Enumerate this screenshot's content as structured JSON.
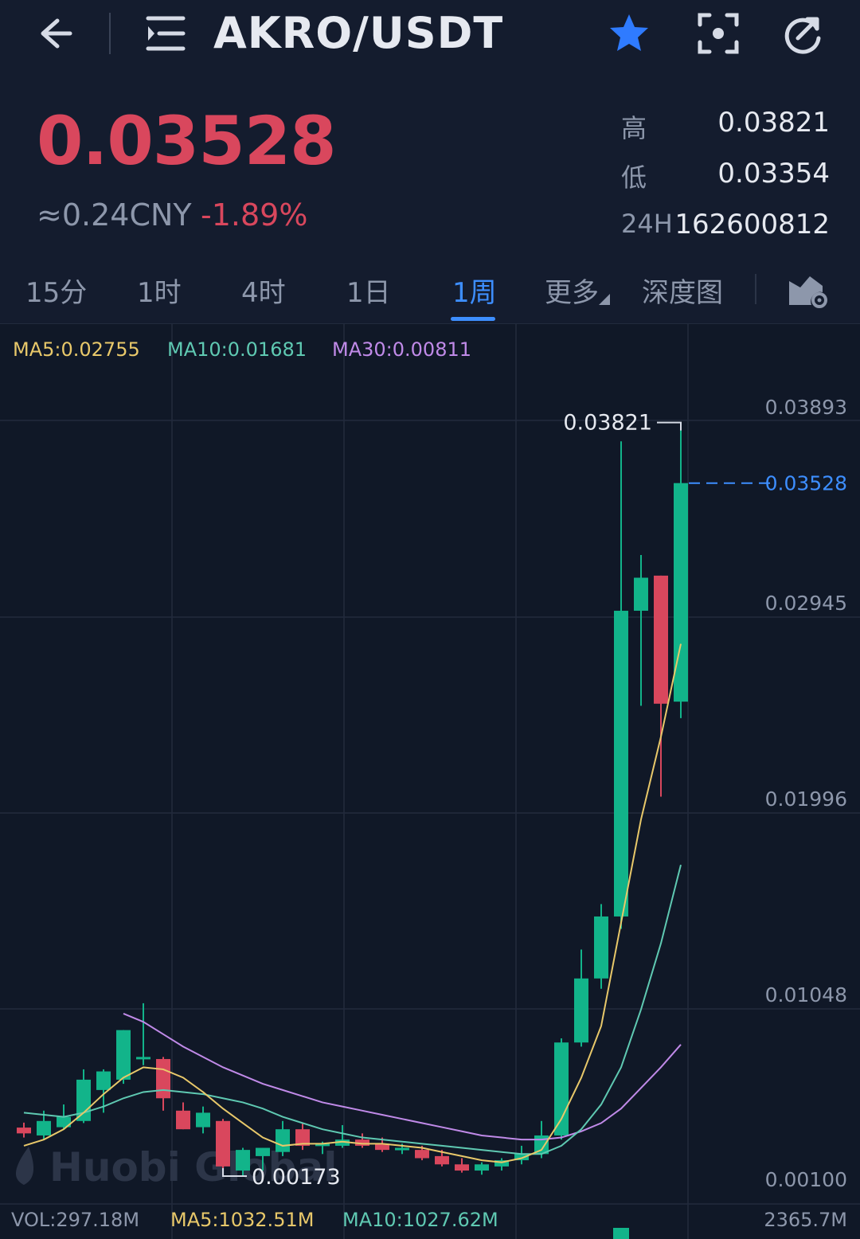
{
  "header": {
    "title": "AKRO/USDT"
  },
  "ticker": {
    "last_price": "0.03528",
    "cny": "≈0.24CNY",
    "change_pct": "-1.89%",
    "high_label": "高",
    "high_value": "0.03821",
    "low_label": "低",
    "low_value": "0.03354",
    "vol_label": "24H",
    "vol_value": "162600812"
  },
  "tabs": [
    {
      "label": "15分"
    },
    {
      "label": "1时"
    },
    {
      "label": "4时"
    },
    {
      "label": "1日"
    },
    {
      "label": "1周"
    },
    {
      "label": "更多"
    },
    {
      "label": "深度图"
    }
  ],
  "active_tab": "1周",
  "indicators": {
    "ma5": "MA5:0.02755",
    "ma10": "MA10:0.01681",
    "ma30": "MA30:0.00811"
  },
  "volume": {
    "vol": "VOL:297.18M",
    "ma5": "MA5:1032.51M",
    "ma10": "MA10:1027.62M",
    "max": "2365.7M"
  },
  "watermark": "Huobi Global",
  "colors": {
    "up": "#12b48a",
    "down": "#d9475d",
    "accent": "#3d8eff",
    "ma5": "#e8c86a",
    "ma10": "#5fc9b2",
    "ma30": "#c08ae8"
  },
  "chart_data": {
    "type": "candlestick",
    "y_axis_labels": [
      "0.03893",
      "0.02945",
      "0.01996",
      "0.01048",
      "0.00100"
    ],
    "ylim": [
      0.001,
      0.03893
    ],
    "current_price_label": "0.03528",
    "max_label": "0.03821",
    "min_label": "0.00173",
    "candles": [
      {
        "o": 0.00408,
        "h": 0.00432,
        "l": 0.0036,
        "c": 0.0038
      },
      {
        "o": 0.0037,
        "h": 0.0049,
        "l": 0.0035,
        "c": 0.0044
      },
      {
        "o": 0.0041,
        "h": 0.0052,
        "l": 0.004,
        "c": 0.0046
      },
      {
        "o": 0.0044,
        "h": 0.0069,
        "l": 0.0043,
        "c": 0.0064
      },
      {
        "o": 0.0059,
        "h": 0.0069,
        "l": 0.0048,
        "c": 0.0068
      },
      {
        "o": 0.0064,
        "h": 0.0077,
        "l": 0.0062,
        "c": 0.0088
      },
      {
        "o": 0.0074,
        "h": 0.0101,
        "l": 0.0071,
        "c": 0.0075
      },
      {
        "o": 0.0074,
        "h": 0.0075,
        "l": 0.0049,
        "c": 0.0055
      },
      {
        "o": 0.0049,
        "h": 0.0053,
        "l": 0.0043,
        "c": 0.004
      },
      {
        "o": 0.0041,
        "h": 0.0051,
        "l": 0.0038,
        "c": 0.0048
      },
      {
        "o": 0.0044,
        "h": 0.0045,
        "l": 0.00173,
        "c": 0.0022
      },
      {
        "o": 0.002,
        "h": 0.0031,
        "l": 0.00173,
        "c": 0.003
      },
      {
        "o": 0.0027,
        "h": 0.0031,
        "l": 0.002,
        "c": 0.0031
      },
      {
        "o": 0.0029,
        "h": 0.0044,
        "l": 0.0027,
        "c": 0.004
      },
      {
        "o": 0.004,
        "h": 0.0043,
        "l": 0.003,
        "c": 0.0032
      },
      {
        "o": 0.0032,
        "h": 0.0034,
        "l": 0.0028,
        "c": 0.0033
      },
      {
        "o": 0.0032,
        "h": 0.0042,
        "l": 0.0031,
        "c": 0.0035
      },
      {
        "o": 0.0035,
        "h": 0.0038,
        "l": 0.0031,
        "c": 0.0032
      },
      {
        "o": 0.0033,
        "h": 0.0036,
        "l": 0.0029,
        "c": 0.003
      },
      {
        "o": 0.003,
        "h": 0.0033,
        "l": 0.0028,
        "c": 0.0031
      },
      {
        "o": 0.003,
        "h": 0.0032,
        "l": 0.0025,
        "c": 0.0026
      },
      {
        "o": 0.0027,
        "h": 0.003,
        "l": 0.0022,
        "c": 0.0023
      },
      {
        "o": 0.0023,
        "h": 0.0026,
        "l": 0.0019,
        "c": 0.002
      },
      {
        "o": 0.002,
        "h": 0.0024,
        "l": 0.0018,
        "c": 0.0023
      },
      {
        "o": 0.0022,
        "h": 0.0026,
        "l": 0.002,
        "c": 0.0025
      },
      {
        "o": 0.0025,
        "h": 0.0032,
        "l": 0.0023,
        "c": 0.0028
      },
      {
        "o": 0.0028,
        "h": 0.0044,
        "l": 0.0026,
        "c": 0.0037
      },
      {
        "o": 0.0037,
        "h": 0.0084,
        "l": 0.0035,
        "c": 0.0082
      },
      {
        "o": 0.0082,
        "h": 0.0127,
        "l": 0.008,
        "c": 0.0113
      },
      {
        "o": 0.0113,
        "h": 0.0149,
        "l": 0.0108,
        "c": 0.0143
      },
      {
        "o": 0.0143,
        "h": 0.0373,
        "l": 0.0137,
        "c": 0.0291
      },
      {
        "o": 0.0291,
        "h": 0.0318,
        "l": 0.0245,
        "c": 0.0307
      },
      {
        "o": 0.0308,
        "h": 0.029,
        "l": 0.0201,
        "c": 0.0246
      },
      {
        "o": 0.0247,
        "h": 0.03821,
        "l": 0.0239,
        "c": 0.03528
      }
    ],
    "ma5": [
      0.0032,
      0.0035,
      0.004,
      0.0048,
      0.0057,
      0.0065,
      0.007,
      0.0069,
      0.0065,
      0.0058,
      0.005,
      0.0043,
      0.0036,
      0.0032,
      0.0033,
      0.0033,
      0.0034,
      0.0033,
      0.0033,
      0.0032,
      0.0031,
      0.0029,
      0.0027,
      0.0025,
      0.0024,
      0.0026,
      0.003,
      0.0045,
      0.0065,
      0.009,
      0.014,
      0.019,
      0.023,
      0.0275
    ],
    "ma10": [
      0.0048,
      0.0047,
      0.0046,
      0.0048,
      0.0051,
      0.0055,
      0.0058,
      0.0059,
      0.0058,
      0.0057,
      0.0055,
      0.0053,
      0.005,
      0.0046,
      0.0043,
      0.004,
      0.0038,
      0.0036,
      0.0035,
      0.0034,
      0.0033,
      0.0032,
      0.0031,
      0.003,
      0.0029,
      0.0028,
      0.0028,
      0.0032,
      0.004,
      0.0052,
      0.007,
      0.0098,
      0.013,
      0.0168
    ],
    "ma30": [
      null,
      null,
      null,
      null,
      null,
      0.0096,
      0.0092,
      0.0086,
      0.008,
      0.0075,
      0.007,
      0.0066,
      0.0062,
      0.0059,
      0.0056,
      0.0053,
      0.0051,
      0.0049,
      0.0047,
      0.0045,
      0.0043,
      0.0041,
      0.0039,
      0.0037,
      0.0036,
      0.0035,
      0.0035,
      0.0036,
      0.0039,
      0.0043,
      0.005,
      0.006,
      0.007,
      0.0081
    ]
  }
}
